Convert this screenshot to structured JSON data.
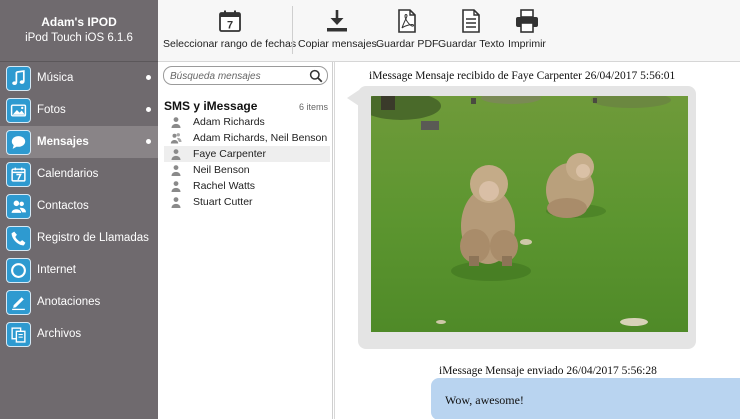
{
  "device": {
    "name": "Adam's IPOD",
    "model": "iPod Touch iOS 6.1.6"
  },
  "nav": [
    {
      "label": "Música",
      "icon": "music-icon",
      "dot": true
    },
    {
      "label": "Fotos",
      "icon": "photos-icon",
      "dot": true
    },
    {
      "label": "Mensajes",
      "icon": "messages-icon",
      "dot": true,
      "active": true
    },
    {
      "label": "Calendarios",
      "icon": "calendar-icon"
    },
    {
      "label": "Contactos",
      "icon": "contacts-icon"
    },
    {
      "label": "Registro de Llamadas",
      "icon": "phone-icon"
    },
    {
      "label": "Internet",
      "icon": "internet-icon"
    },
    {
      "label": "Anotaciones",
      "icon": "notes-icon"
    },
    {
      "label": "Archivos",
      "icon": "files-icon"
    }
  ],
  "toolbar": {
    "date_range": "Seleccionar rango de fechas",
    "calendar_day": "7",
    "copy": "Copiar mensajes",
    "save_pdf": "Guardar PDF",
    "save_text": "Guardar Texto",
    "print": "Imprimir"
  },
  "search": {
    "placeholder": "Búsqueda mensajes"
  },
  "section": {
    "title": "SMS y iMessage",
    "count": "6 items"
  },
  "contacts": [
    {
      "name": "Adam Richards"
    },
    {
      "name": "Adam Richards, Neil Benson",
      "group": true
    },
    {
      "name": "Faye Carpenter",
      "selected": true
    },
    {
      "name": "Neil Benson"
    },
    {
      "name": "Rachel Watts"
    },
    {
      "name": "Stuart Cutter"
    }
  ],
  "conversation": {
    "received_meta": "iMessage Mensaje recibido de Faye Carpenter 26/04/2017 5:56:01",
    "sent_meta": "iMessage Mensaje enviado 26/04/2017 5:56:28",
    "sent_text": "Wow, awesome!"
  },
  "colors": {
    "sidebar": "#6f6a6e",
    "accent": "#2e9ad0",
    "sent_bubble": "#b9d4f0",
    "received_bubble": "#e4e4e4"
  }
}
